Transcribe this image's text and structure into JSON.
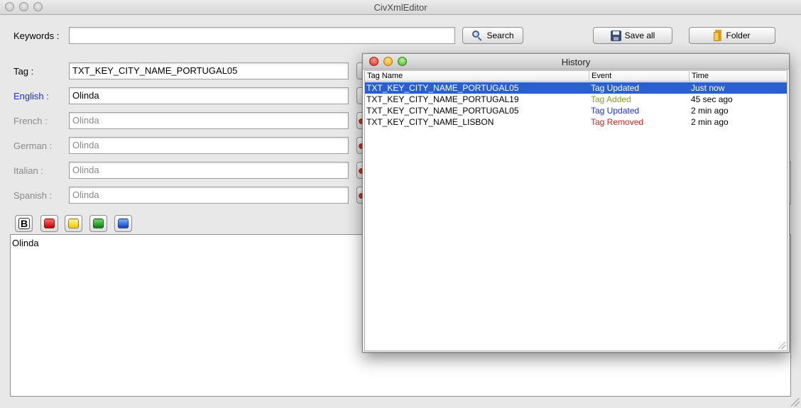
{
  "window": {
    "title": "CivXmlEditor"
  },
  "search": {
    "label": "Keywords :",
    "value": "",
    "button_label": "Search"
  },
  "toolbar": {
    "save_all_label": "Save all",
    "folder_label": "Folder"
  },
  "fields": {
    "tag": {
      "label": "Tag :",
      "value": "TXT_KEY_CITY_NAME_PORTUGAL05"
    },
    "english": {
      "label": "English :",
      "value": "Olinda"
    },
    "french": {
      "label": "French :",
      "value": "Olinda"
    },
    "german": {
      "label": "German :",
      "value": "Olinda"
    },
    "italian": {
      "label": "Italian :",
      "value": "Olinda"
    },
    "spanish": {
      "label": "Spanish :",
      "value": "Olinda"
    }
  },
  "format_toolbar": {
    "bold_label": "B",
    "colors": {
      "red": "#d81c1c",
      "yellow": "#ffe31a",
      "green": "#1e9e25",
      "blue": "#1e5ee0"
    }
  },
  "editor": {
    "text": "Olinda"
  },
  "history": {
    "title": "History",
    "columns": [
      "Tag Name",
      "Event",
      "Time"
    ],
    "rows": [
      {
        "tag": "TXT_KEY_CITY_NAME_PORTUGAL05",
        "event": "Tag Updated",
        "time": "Just now",
        "event_color": "#ffffff",
        "selected": true
      },
      {
        "tag": "TXT_KEY_CITY_NAME_PORTUGAL19",
        "event": "Tag Added",
        "time": "45 sec ago",
        "event_color": "#86a21a",
        "selected": false
      },
      {
        "tag": "TXT_KEY_CITY_NAME_PORTUGAL05",
        "event": "Tag Updated",
        "time": "2 min ago",
        "event_color": "#1c2fd0",
        "selected": false
      },
      {
        "tag": "TXT_KEY_CITY_NAME_LISBON",
        "event": "Tag Removed",
        "time": "2 min ago",
        "event_color": "#e11d1d",
        "selected": false
      }
    ]
  },
  "colors": {
    "selection": "#2a5fd4",
    "label_active": "#1c2fd0",
    "label_disabled": "#8a8a8a"
  }
}
